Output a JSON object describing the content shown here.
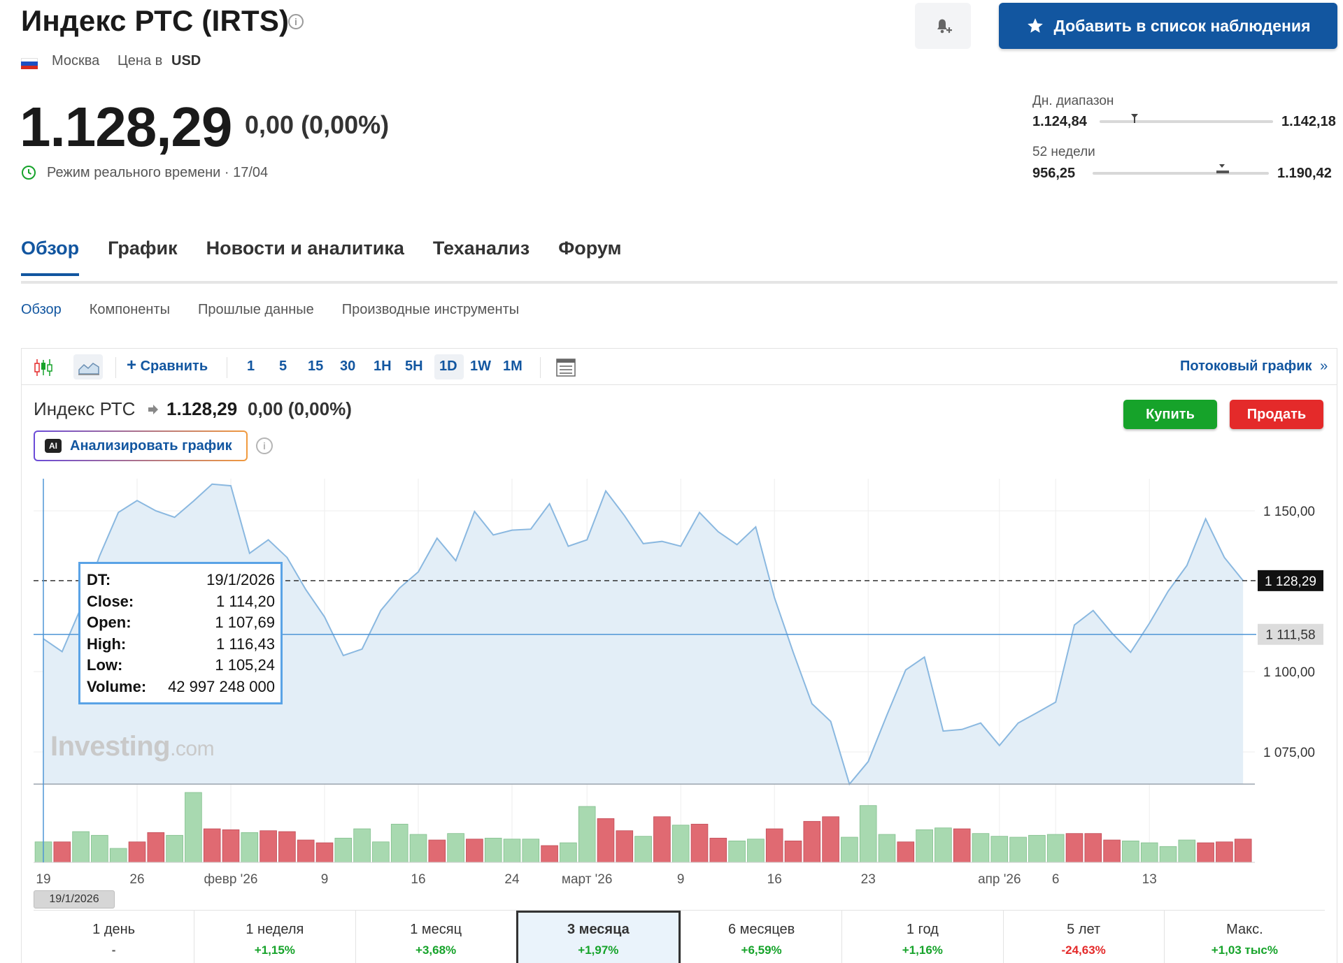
{
  "header": {
    "title": "Индекс РТС (IRTS)",
    "exchange": "Москва",
    "currency_prefix": "Цена в",
    "currency": "USD",
    "alert_icon": "bell-plus-icon",
    "watchlist_label": "Добавить в список наблюдения"
  },
  "quote": {
    "price": "1.128,29",
    "change": "0,00 (0,00%)",
    "realtime_label": "Режим реального времени · 17/04"
  },
  "ranges": {
    "day_label": "Дн. диапазон",
    "day_low": "1.124,84",
    "day_high": "1.142,18",
    "day_position": 0.2,
    "week52_label": "52 недели",
    "week52_low": "956,25",
    "week52_high": "1.190,42",
    "week52_position": 0.74
  },
  "tabs": [
    "Обзор",
    "График",
    "Новости и аналитика",
    "Теханализ",
    "Форум"
  ],
  "subtabs": [
    "Обзор",
    "Компоненты",
    "Прошлые данные",
    "Производные инструменты"
  ],
  "toolbar": {
    "compare_label": "Сравнить",
    "intervals": [
      "1",
      "5",
      "15",
      "30",
      "1H",
      "5H",
      "1D",
      "1W",
      "1M"
    ],
    "selected_interval": "1D",
    "streaming_label": "Потоковый график"
  },
  "chart_header": {
    "name": "Индекс РТС",
    "price": "1.128,29",
    "change": "0,00 (0,00%)",
    "ai_badge": "AI",
    "ai_label": "Анализировать график",
    "buy_label": "Купить",
    "sell_label": "Продать"
  },
  "tooltip": {
    "rows": [
      {
        "k": "DT:",
        "v": "19/1/2026"
      },
      {
        "k": "Close:",
        "v": "1 114,20"
      },
      {
        "k": "Open:",
        "v": "1 107,69"
      },
      {
        "k": "High:",
        "v": "1 116,43"
      },
      {
        "k": "Low:",
        "v": "1 105,24"
      },
      {
        "k": "Volume:",
        "v": "42 997 248 000"
      }
    ]
  },
  "watermark": {
    "brand": "Investing",
    "suffix": ".com"
  },
  "crosshair_date": "19/1/2026",
  "chart_data": {
    "type": "area",
    "y_axis_ticks": [
      "1 150,00",
      "1 100,00",
      "1 075,00"
    ],
    "y_tick_values": [
      1150,
      1100,
      1075
    ],
    "ylim": [
      1065,
      1160
    ],
    "last_price_label": "1 128,29",
    "last_price": 1128.29,
    "crosshair_label": "1 111,58",
    "crosshair_value": 1111.58,
    "x_labels": [
      "19",
      "26",
      "февр '26",
      "9",
      "16",
      "24",
      "март '26",
      "9",
      "16",
      "23",
      "апр '26",
      "6",
      "13"
    ],
    "x_label_index": [
      0,
      5,
      10,
      15,
      20,
      25,
      29,
      34,
      39,
      44,
      51,
      54,
      59
    ],
    "close": [
      1110.2,
      1106.2,
      1119.8,
      1136.0,
      1149.5,
      1153.2,
      1150.0,
      1148.0,
      1153.0,
      1158.3,
      1157.8,
      1136.8,
      1141.0,
      1135.5,
      1125.5,
      1117.0,
      1105.0,
      1107.0,
      1119.0,
      1126.0,
      1131.0,
      1141.5,
      1134.5,
      1149.8,
      1142.5,
      1144.0,
      1144.3,
      1152.2,
      1139.0,
      1141.0,
      1156.2,
      1148.5,
      1139.8,
      1140.5,
      1139.0,
      1149.5,
      1143.5,
      1139.5,
      1145.0,
      1123.0,
      1106.0,
      1090.0,
      1084.5,
      1065.0,
      1072.0,
      1086.5,
      1100.5,
      1104.5,
      1081.5,
      1082.0,
      1084.0,
      1077.0,
      1084.0,
      1087.2,
      1090.5,
      1114.5,
      1119.0,
      1112.0,
      1106.0,
      1115.0,
      1125.0,
      1133.0,
      1147.5,
      1135.5,
      1128.29
    ],
    "volume": [
      22,
      22,
      33,
      29,
      15,
      22,
      32,
      29,
      75,
      36,
      35,
      32,
      34,
      33,
      24,
      21,
      26,
      36,
      22,
      41,
      30,
      24,
      31,
      25,
      26,
      25,
      25,
      18,
      21,
      60,
      47,
      34,
      28,
      49,
      40,
      41,
      26,
      23,
      25,
      36,
      23,
      44,
      49,
      27,
      61,
      30,
      22,
      35,
      37,
      36,
      31,
      28,
      27,
      29,
      30,
      31,
      31,
      24,
      23,
      21,
      17,
      24,
      21,
      22,
      25,
      36
    ],
    "volume_up": [
      true,
      false,
      true,
      true,
      true,
      false,
      false,
      true,
      true,
      false,
      false,
      true,
      false,
      false,
      false,
      false,
      true,
      true,
      true,
      true,
      true,
      false,
      true,
      false,
      true,
      true,
      true,
      false,
      true,
      true,
      false,
      false,
      true,
      false,
      true,
      false,
      false,
      true,
      true,
      false,
      false,
      false,
      false,
      true,
      true,
      true,
      false,
      true,
      true,
      false,
      true,
      true,
      true,
      true,
      true,
      false,
      false,
      false,
      true,
      true,
      true,
      true,
      false,
      false,
      false
    ],
    "grid": true
  },
  "periods": [
    {
      "label": "1 день",
      "value": "-",
      "trend": "neu"
    },
    {
      "label": "1 неделя",
      "value": "+1,15%",
      "trend": "pos"
    },
    {
      "label": "1 месяц",
      "value": "+3,68%",
      "trend": "pos"
    },
    {
      "label": "3 месяца",
      "value": "+1,97%",
      "trend": "pos",
      "active": true
    },
    {
      "label": "6 месяцев",
      "value": "+6,59%",
      "trend": "pos"
    },
    {
      "label": "1 год",
      "value": "+1,16%",
      "trend": "pos"
    },
    {
      "label": "5 лет",
      "value": "-24,63%",
      "trend": "neg"
    },
    {
      "label": "Макс.",
      "value": "+1,03 тыс%",
      "trend": "pos"
    }
  ],
  "colors": {
    "accent": "#1256a0",
    "up": "#16a32a",
    "down": "#e42a2a",
    "volume_up": "#a8d9b0",
    "volume_down": "#e06a72",
    "area_fill": "#e3eef7",
    "line": "#8ab8e0"
  }
}
